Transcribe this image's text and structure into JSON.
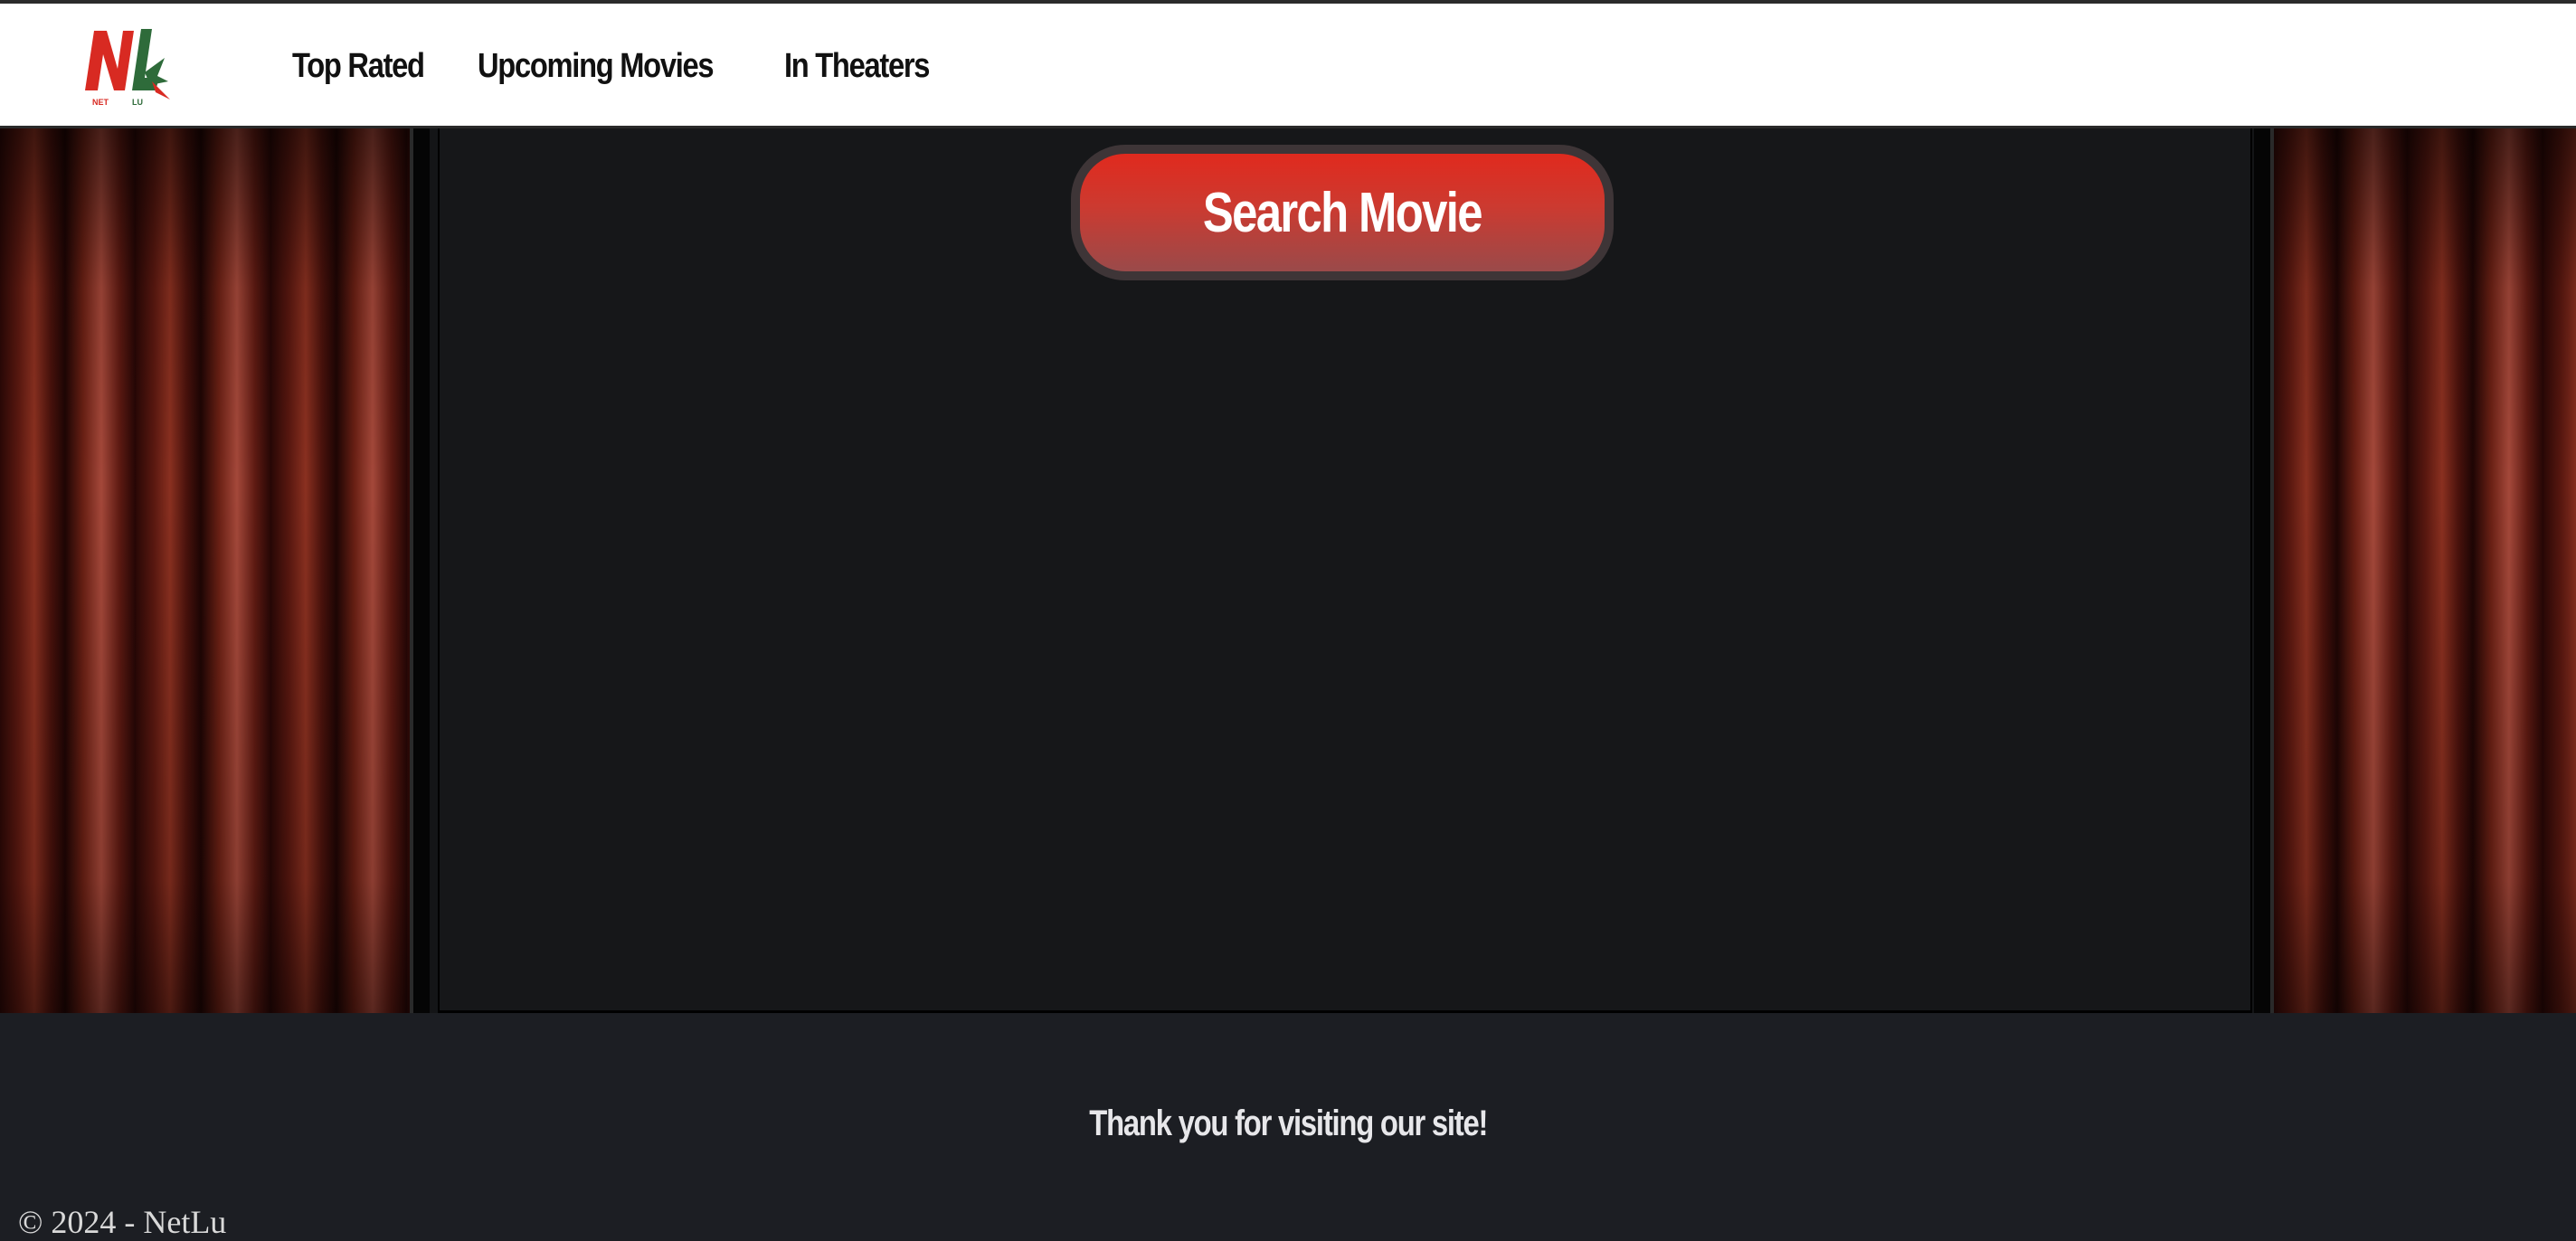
{
  "header": {
    "logo": {
      "text_main": "NL",
      "text_left": "NET",
      "text_right": "LU",
      "colors": {
        "red": "#d82a22",
        "green": "#2e6b3a"
      }
    },
    "nav": [
      {
        "label": "Top Rated"
      },
      {
        "label": "Upcoming Movies"
      },
      {
        "label": "In Theaters"
      }
    ]
  },
  "main": {
    "search_button": {
      "label": "Search Movie",
      "color": "#e02a1e"
    },
    "curtain_color": "#8a3020"
  },
  "footer": {
    "thanks": "Thank you for visiting our site!",
    "copyright": "© 2024 - NetLu"
  }
}
